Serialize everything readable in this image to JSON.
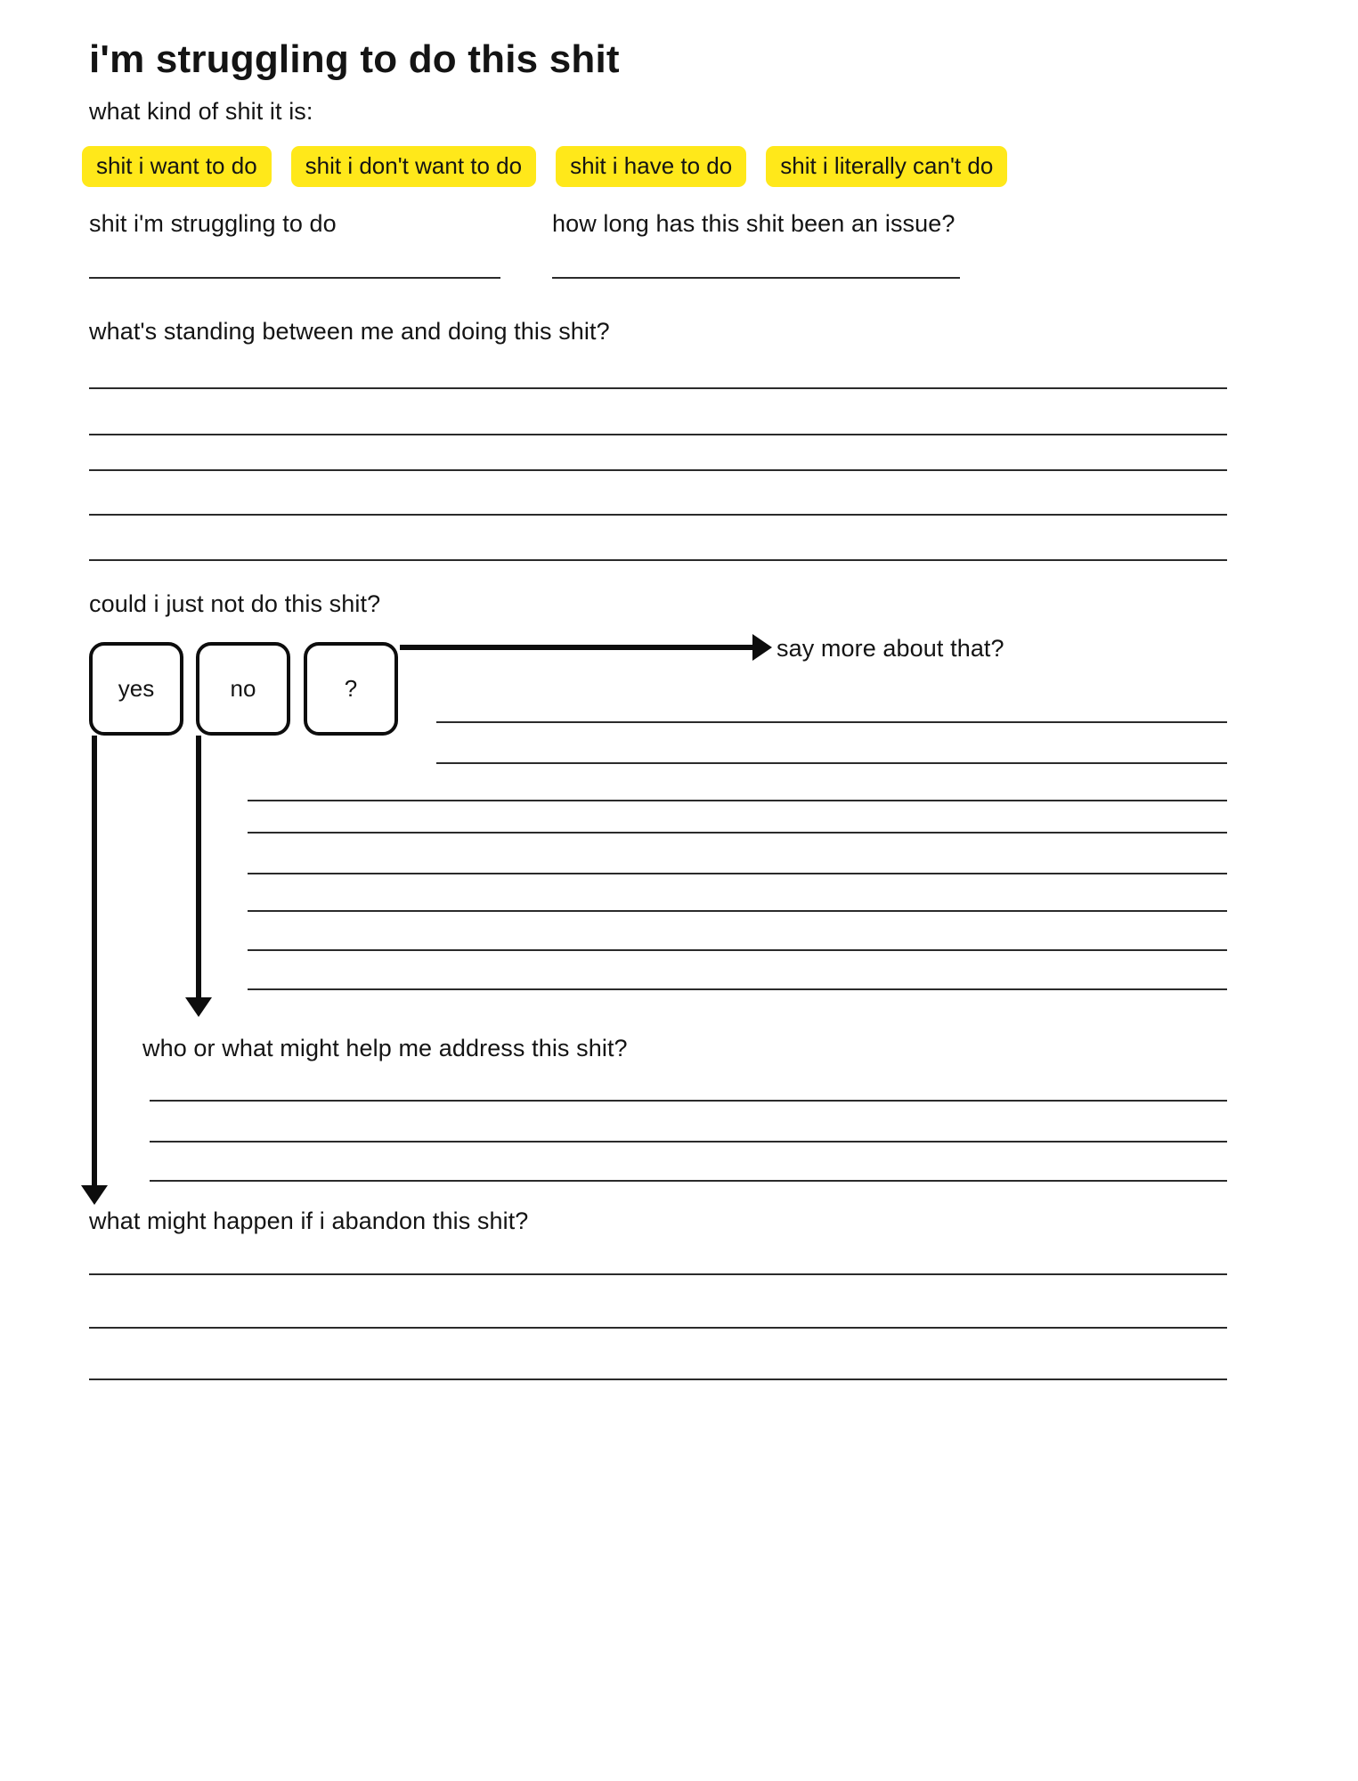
{
  "worksheet": {
    "title": "i'm struggling to do this shit",
    "category_prompt": "what kind of shit it is:",
    "categories": [
      "shit i want to do",
      "shit i don't want to do",
      "shit i have to do",
      "shit i literally can't do"
    ],
    "highlight_color": "#FFE81A",
    "ink_color": "#141414",
    "rule_color": "#2b2b2b",
    "fields": {
      "struggling": {
        "label": "shit i'm struggling to do",
        "value": "",
        "lines": 1
      },
      "duration": {
        "label": "how long has this shit been an issue?",
        "value": "",
        "lines": 1
      },
      "obstacles": {
        "label": "what's standing between me and doing this shit?",
        "value": "",
        "lines": 5
      },
      "could_not_do": {
        "label": "could i just not do this shit?",
        "options": [
          "yes",
          "no",
          "?"
        ],
        "selected": ""
      },
      "say_more": {
        "label": "say more about that?",
        "value": "",
        "lines": 8
      },
      "help": {
        "label": "who or what might help me address this shit?",
        "value": "",
        "lines": 3
      },
      "abandon": {
        "label": "what might happen if i abandon this shit?",
        "value": "",
        "lines": 3
      }
    }
  }
}
